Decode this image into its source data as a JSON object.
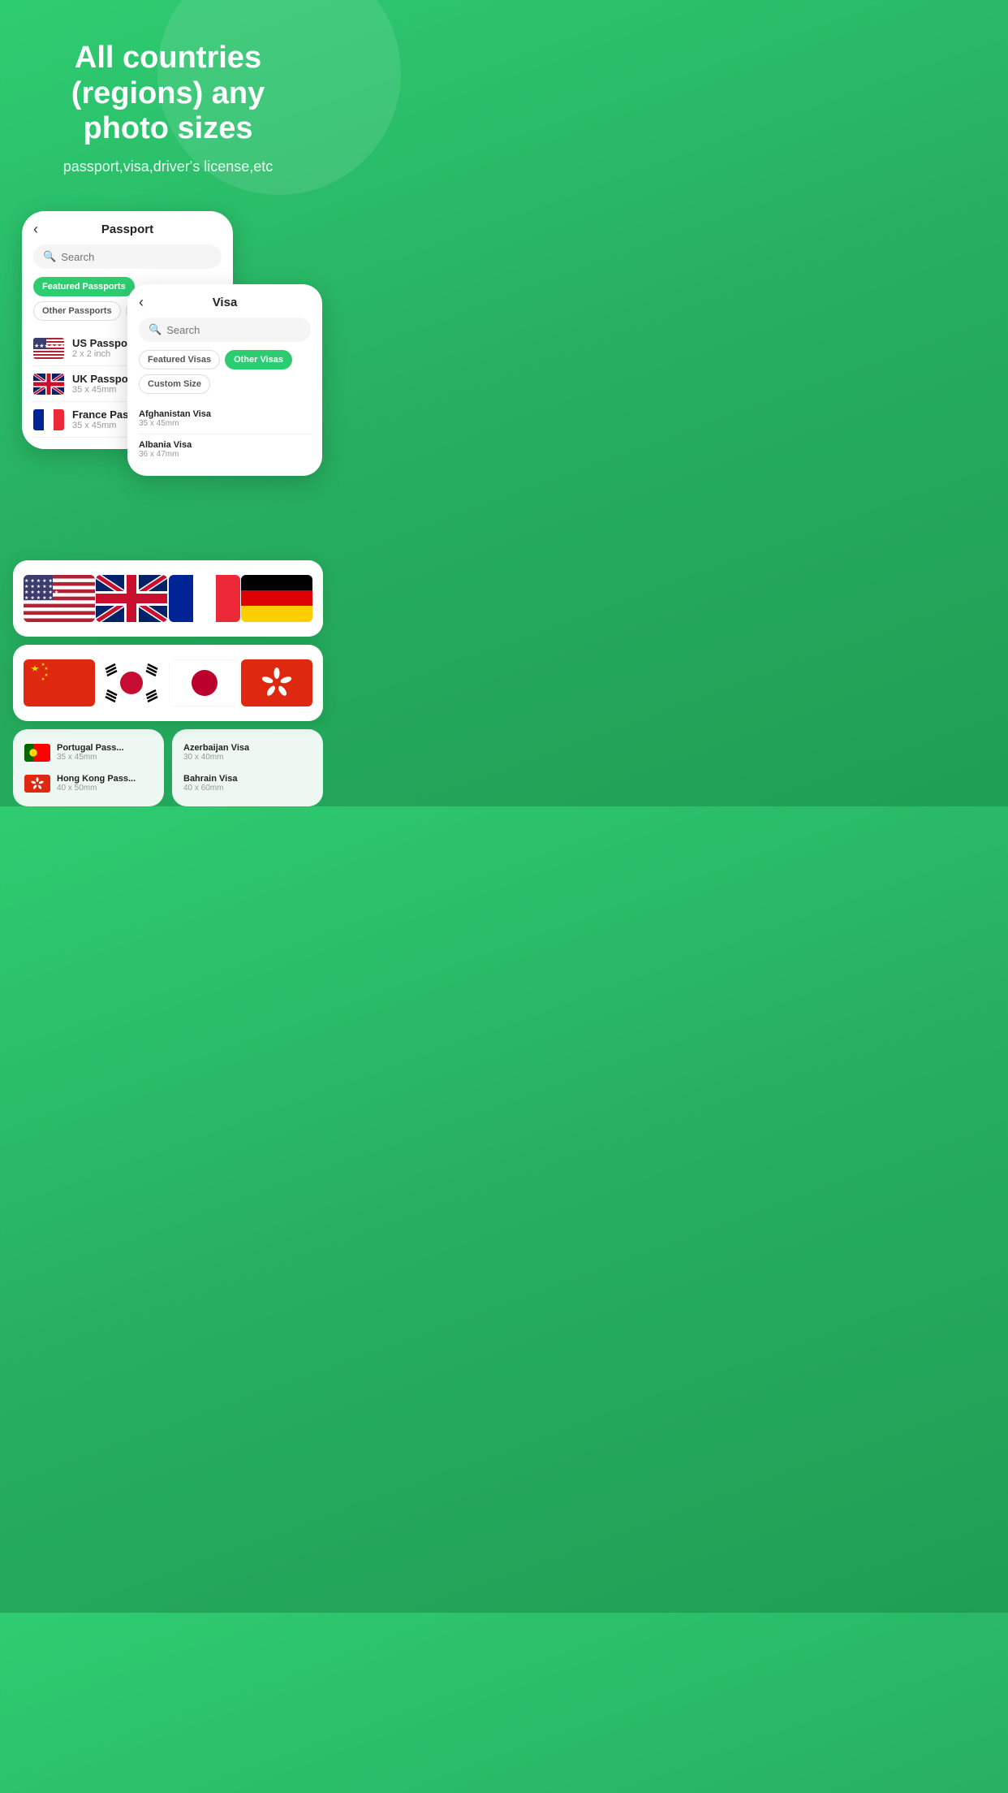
{
  "hero": {
    "title": "All countries (regions) any photo sizes",
    "subtitle": "passport,visa,driver's license,etc"
  },
  "passport_phone": {
    "back_label": "‹",
    "title": "Passport",
    "search_placeholder": "Search",
    "tabs": [
      {
        "label": "Featured Passports",
        "active": true
      },
      {
        "label": "Other Passports",
        "active": false
      },
      {
        "label": "Custom Size",
        "active": false
      }
    ],
    "items": [
      {
        "name": "US Passport",
        "size": "2 x 2 inch"
      },
      {
        "name": "UK Passport",
        "size": "35 x 45mm"
      },
      {
        "name": "France Passport",
        "size": "35 x 45mm"
      }
    ]
  },
  "visa_phone": {
    "back_label": "‹",
    "title": "Visa",
    "search_placeholder": "Search",
    "tabs": [
      {
        "label": "Featured Visas",
        "active": false
      },
      {
        "label": "Other Visas",
        "active": true
      },
      {
        "label": "Custom Size",
        "active": false
      }
    ],
    "items": [
      {
        "name": "Afghanistan Visa",
        "size": "35 x 45mm"
      },
      {
        "name": "Albania Visa",
        "size": "36 x 47mm"
      }
    ]
  },
  "flags_row1": [
    {
      "country": "US",
      "label": "United States"
    },
    {
      "country": "UK",
      "label": "United Kingdom"
    },
    {
      "country": "FR",
      "label": "France"
    },
    {
      "country": "DE",
      "label": "Germany"
    }
  ],
  "flags_row2": [
    {
      "country": "CN",
      "label": "China"
    },
    {
      "country": "KR",
      "label": "South Korea"
    },
    {
      "country": "JP",
      "label": "Japan"
    },
    {
      "country": "HK",
      "label": "Hong Kong"
    }
  ],
  "bottom_passports": [
    {
      "name": "Portugal Pass...",
      "size": "35 x 45mm"
    },
    {
      "name": "Hong Kong Pass...",
      "size": "40 x 50mm"
    }
  ],
  "bottom_visas": [
    {
      "name": "Azerbaijan Visa",
      "size": "30 x 40mm"
    },
    {
      "name": "Bahrain Visa",
      "size": "40 x 60mm"
    }
  ]
}
